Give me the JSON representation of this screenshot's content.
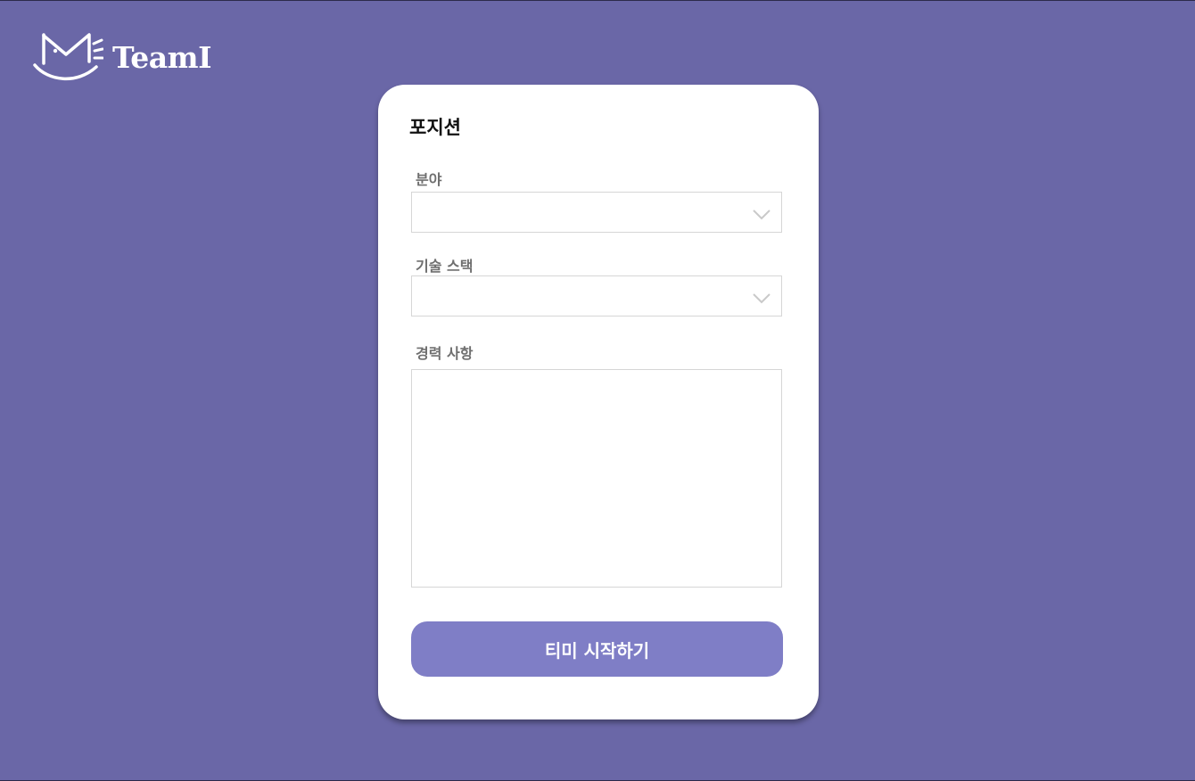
{
  "brand": {
    "name": "TeamI",
    "icon": "cat-face-icon"
  },
  "form": {
    "title": "포지션",
    "field_label": "분야",
    "field_value": "",
    "stack_label": "기술 스택",
    "stack_value": "",
    "career_label": "경력 사항",
    "career_value": "",
    "submit_label": "티미 시작하기"
  },
  "colors": {
    "background": "#6a67a7",
    "card": "#ffffff",
    "button": "#7f7ec6",
    "border": "#d6d6d6"
  }
}
